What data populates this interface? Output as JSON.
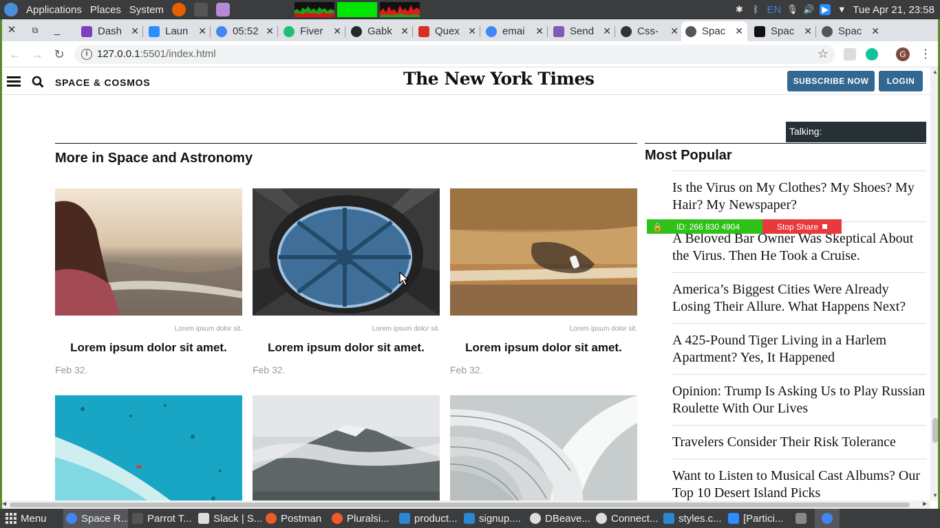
{
  "os_panel": {
    "menus": [
      "Applications",
      "Places",
      "System"
    ],
    "tray": {
      "lang": "EN",
      "datetime": "Tue Apr 21, 23:58"
    }
  },
  "tabs": [
    {
      "title": "Dash",
      "color": "#7b3fbf",
      "active": false
    },
    {
      "title": "Laun",
      "color": "#2d8cff",
      "active": false
    },
    {
      "title": "05:52",
      "color": "#4285f4",
      "active": false
    },
    {
      "title": "Fiver",
      "color": "#1dbf73",
      "active": false
    },
    {
      "title": "Gabk",
      "color": "#24292e",
      "active": false
    },
    {
      "title": "Quex",
      "color": "#d93025",
      "active": false
    },
    {
      "title": "emai",
      "color": "#4285f4",
      "active": false
    },
    {
      "title": "Send",
      "color": "#7e5bb7",
      "active": false
    },
    {
      "title": "Css-",
      "color": "#333333",
      "active": false
    },
    {
      "title": "Spac",
      "color": "#555555",
      "active": true
    },
    {
      "title": "Spac",
      "color": "#111111",
      "active": false
    },
    {
      "title": "Spac",
      "color": "#555555",
      "active": false
    }
  ],
  "address": {
    "host": "127.0.0.1",
    "rest": ":5501/index.html"
  },
  "profile_initial": "G",
  "site": {
    "section": "SPACE & COSMOS",
    "masthead": "The New York Times",
    "subscribe_label": "SUBSCRIBE NOW",
    "login_label": "LOGIN"
  },
  "more": {
    "heading": "More in Space and Astronomy",
    "cards": [
      {
        "credit": "Lorem ipsum dolor sit.",
        "title": "Lorem ipsum dolor sit amet.",
        "date": "Feb 32."
      },
      {
        "credit": "Lorem ipsum dolor sit.",
        "title": "Lorem ipsum dolor sit amet.",
        "date": "Feb 32."
      },
      {
        "credit": "Lorem ipsum dolor sit.",
        "title": "Lorem ipsum dolor sit amet.",
        "date": "Feb 32."
      }
    ]
  },
  "talking_label": "Talking:",
  "popular": {
    "heading": "Most Popular",
    "items": [
      "Is the Virus on My Clothes? My Shoes? My Hair? My Newspaper?",
      "A Beloved Bar Owner Was Skeptical About the Virus. Then He Took a Cruise.",
      "America’s Biggest Cities Were Already Losing Their Allure. What Happens Next?",
      "A 425-Pound Tiger Living in a Harlem Apartment? Yes, It Happened",
      "Opinion: Trump Is Asking Us to Play Russian Roulette With Our Lives",
      "Travelers Consider Their Risk Tolerance",
      "Want to Listen to Musical Cast Albums? Our Top 10 Desert Island Picks"
    ]
  },
  "zoom": {
    "id": "ID: 266 830 4904",
    "stop": "Stop Share"
  },
  "taskbar": [
    {
      "label": "Menu"
    },
    {
      "label": "Space R...",
      "color": "#4285f4"
    },
    {
      "label": "Parrot T...",
      "color": "#555555"
    },
    {
      "label": "Slack | S...",
      "color": "#dddddd"
    },
    {
      "label": "Postman",
      "color": "#ef5b25"
    },
    {
      "label": "Pluralsi...",
      "color": "#f15b2a"
    },
    {
      "label": "product...",
      "color": "#2b87d1"
    },
    {
      "label": "signup....",
      "color": "#2b87d1"
    },
    {
      "label": "DBeave...",
      "color": "#dddddd"
    },
    {
      "label": "Connect...",
      "color": "#dddddd"
    },
    {
      "label": "styles.c...",
      "color": "#2b87d1"
    },
    {
      "label": "[Partici...",
      "color": "#2d8cff"
    }
  ]
}
